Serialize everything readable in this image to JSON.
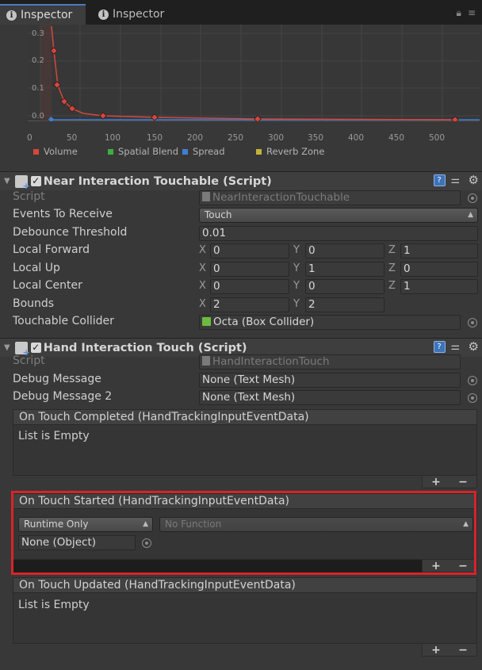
{
  "tabs": [
    {
      "label": "Inspector"
    },
    {
      "label": "Inspector"
    }
  ],
  "graph": {
    "y_ticks": [
      "0.3",
      "0.2",
      "0.1",
      "0.0"
    ],
    "x_ticks": [
      "0",
      "50",
      "100",
      "150",
      "200",
      "250",
      "300",
      "350",
      "400",
      "450",
      "500"
    ],
    "legend": [
      {
        "label": "Volume",
        "color": "#d5473c"
      },
      {
        "label": "Spatial Blend",
        "color": "#3fae3f"
      },
      {
        "label": "Spread",
        "color": "#3f7fd5"
      },
      {
        "label": "Reverb Zone",
        "color": "#c2b43a"
      }
    ]
  },
  "near_touchable": {
    "title": "Near Interaction Touchable (Script)",
    "rows": {
      "script": {
        "label": "Script",
        "value": "NearInteractionTouchable"
      },
      "events": {
        "label": "Events To Receive",
        "value": "Touch"
      },
      "debounce": {
        "label": "Debounce Threshold",
        "value": "0.01"
      },
      "forward": {
        "label": "Local Forward",
        "x": "0",
        "y": "0",
        "z": "1"
      },
      "up": {
        "label": "Local Up",
        "x": "0",
        "y": "1",
        "z": "0"
      },
      "center": {
        "label": "Local Center",
        "x": "0",
        "y": "0",
        "z": "1"
      },
      "bounds": {
        "label": "Bounds",
        "x": "2",
        "y": "2"
      },
      "collider": {
        "label": "Touchable Collider",
        "value": "Octa (Box Collider)"
      }
    },
    "axis": {
      "x": "X",
      "y": "Y",
      "z": "Z"
    }
  },
  "hand_touch": {
    "title": "Hand Interaction Touch (Script)",
    "rows": {
      "script": {
        "label": "Script",
        "value": "HandInteractionTouch"
      },
      "debug1": {
        "label": "Debug Message",
        "value": "None (Text Mesh)"
      },
      "debug2": {
        "label": "Debug Message 2",
        "value": "None (Text Mesh)"
      }
    }
  },
  "events": {
    "completed": {
      "title": "On Touch Completed (HandTrackingInputEventData)",
      "empty": "List is Empty"
    },
    "started": {
      "title": "On Touch Started (HandTrackingInputEventData)",
      "runtime": "Runtime Only",
      "function": "No Function",
      "object": "None (Object)"
    },
    "updated": {
      "title": "On Touch Updated (HandTrackingInputEventData)",
      "empty": "List is Empty"
    },
    "plus": "+",
    "minus": "−"
  }
}
